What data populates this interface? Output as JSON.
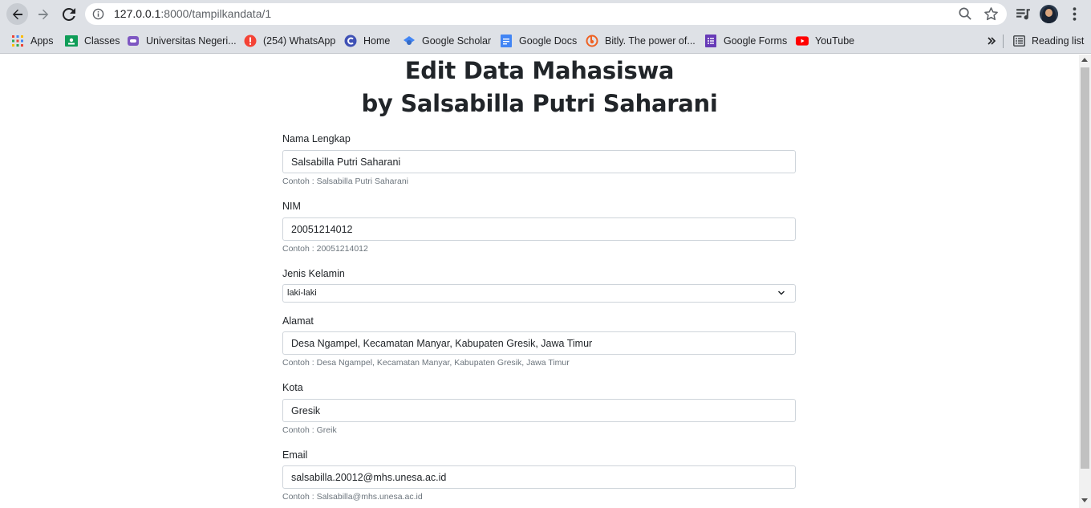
{
  "browser": {
    "url_host": "127.0.0.1",
    "url_path": ":8000/tampilkandata/1"
  },
  "bookmarks": [
    {
      "label": "Apps",
      "icon": "apps-grid-icon"
    },
    {
      "label": "Classes",
      "icon": "google-classroom-icon"
    },
    {
      "label": "Universitas Negeri...",
      "icon": "unesa-icon"
    },
    {
      "label": "(254) WhatsApp",
      "icon": "whatsapp-alert-icon"
    },
    {
      "label": "Home",
      "icon": "home-c-icon"
    },
    {
      "label": "Google Scholar",
      "icon": "google-scholar-icon"
    },
    {
      "label": "Google Docs",
      "icon": "google-docs-icon"
    },
    {
      "label": "Bitly. The power of...",
      "icon": "bitly-icon"
    },
    {
      "label": "Google Forms",
      "icon": "google-forms-icon"
    },
    {
      "label": "YouTube",
      "icon": "youtube-icon"
    }
  ],
  "reading_list_label": "Reading list",
  "page": {
    "title_line1": "Edit Data Mahasiswa",
    "title_line2": "by Salsabilla Putri Saharani"
  },
  "form": {
    "nama": {
      "label": "Nama Lengkap",
      "value": "Salsabilla Putri Saharani",
      "help": "Contoh : Salsabilla Putri Saharani"
    },
    "nim": {
      "label": "NIM",
      "value": "20051214012",
      "help": "Contoh : 20051214012"
    },
    "jenis_kelamin": {
      "label": "Jenis Kelamin",
      "value": "laki-laki"
    },
    "alamat": {
      "label": "Alamat",
      "value": "Desa Ngampel, Kecamatan Manyar, Kabupaten Gresik, Jawa Timur",
      "help": "Contoh : Desa Ngampel, Kecamatan Manyar, Kabupaten Gresik, Jawa Timur"
    },
    "kota": {
      "label": "Kota",
      "value": "Gresik",
      "help": "Contoh : Greik"
    },
    "email": {
      "label": "Email",
      "value": "salsabilla.20012@mhs.unesa.ac.id",
      "help": "Contoh : Salsabilla@mhs.unesa.ac.id"
    }
  }
}
